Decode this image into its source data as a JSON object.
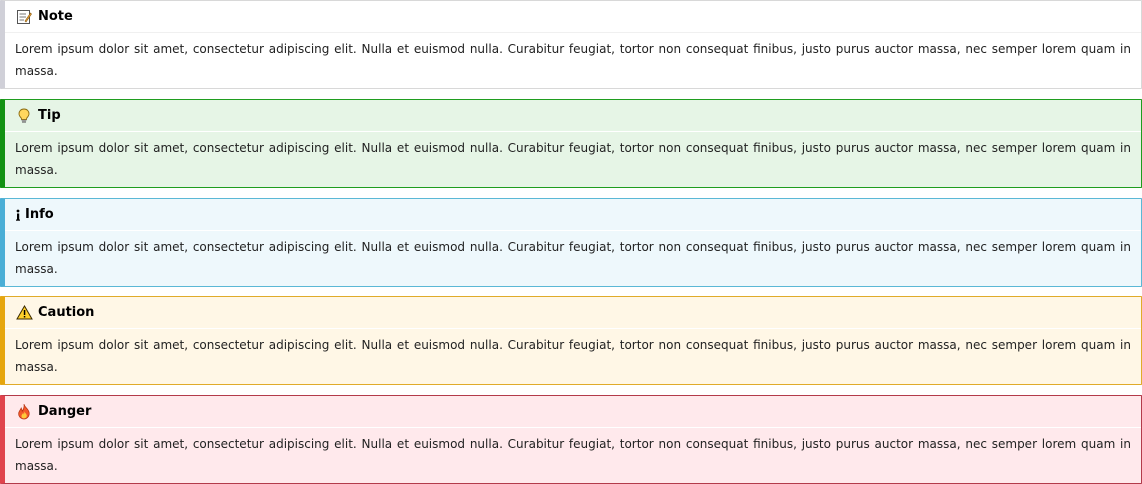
{
  "admonitions": [
    {
      "kind": "note",
      "icon": "memo-icon",
      "title": "Note",
      "text": "Lorem ipsum dolor sit amet, consectetur adipiscing elit. Nulla et euismod nulla. Curabitur feugiat, tortor non consequat finibus, justo purus auctor massa, nec semper lorem quam in massa.",
      "accent": "#d0d0d8"
    },
    {
      "kind": "tip",
      "icon": "lightbulb-icon",
      "title": "Tip",
      "text": "Lorem ipsum dolor sit amet, consectetur adipiscing elit. Nulla et euismod nulla. Curabitur feugiat, tortor non consequat finibus, justo purus auctor massa, nec semper lorem quam in massa.",
      "accent": "#139113"
    },
    {
      "kind": "info",
      "icon": "info-icon",
      "title": "Info",
      "text": "Lorem ipsum dolor sit amet, consectetur adipiscing elit. Nulla et euismod nulla. Curabitur feugiat, tortor non consequat finibus, justo purus auctor massa, nec semper lorem quam in massa.",
      "accent": "#4aaed6"
    },
    {
      "kind": "caution",
      "icon": "warning-icon",
      "title": "Caution",
      "text": "Lorem ipsum dolor sit amet, consectetur adipiscing elit. Nulla et euismod nulla. Curabitur feugiat, tortor non consequat finibus, justo purus auctor massa, nec semper lorem quam in massa.",
      "accent": "#e6a60e"
    },
    {
      "kind": "danger",
      "icon": "fire-icon",
      "title": "Danger",
      "text": "Lorem ipsum dolor sit amet, consectetur adipiscing elit. Nulla et euismod nulla. Curabitur feugiat, tortor non consequat finibus, justo purus auctor massa, nec semper lorem quam in massa.",
      "accent": "#e0434c"
    }
  ]
}
